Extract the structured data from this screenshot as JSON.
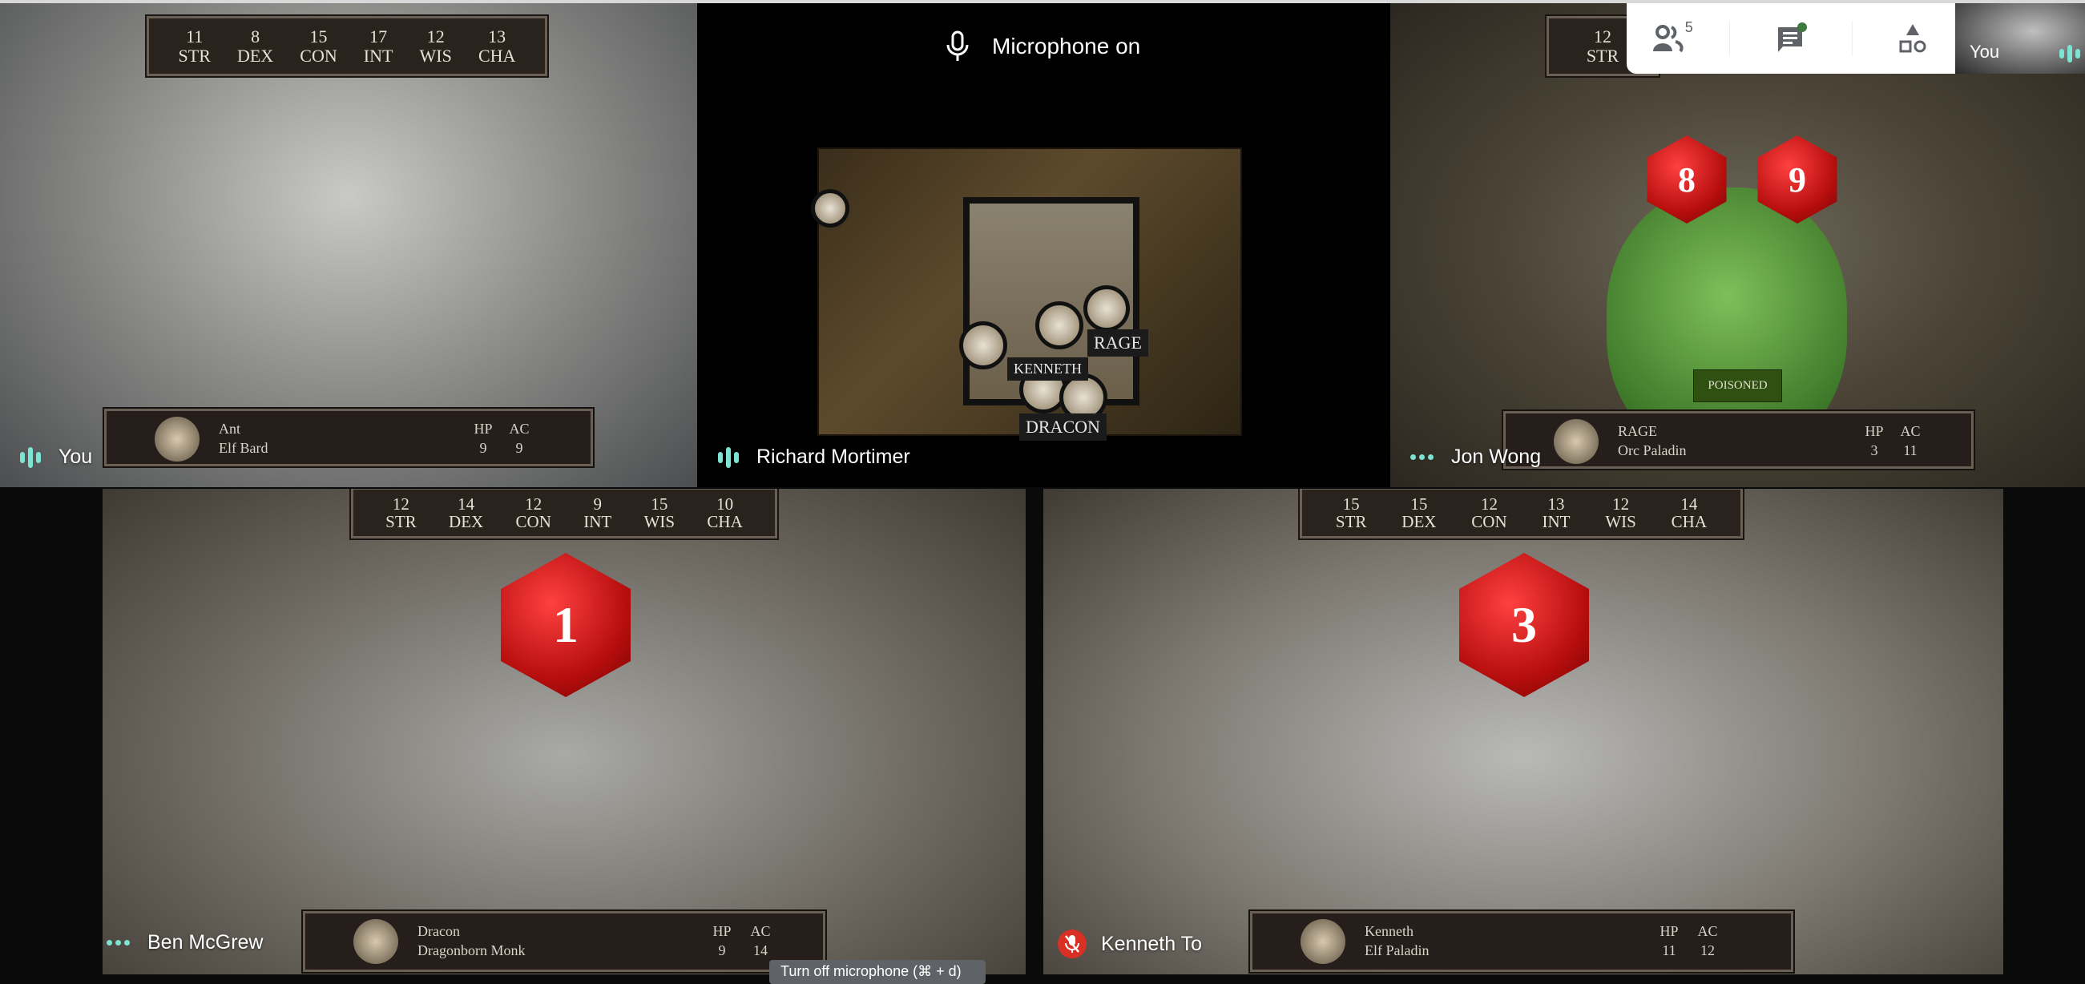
{
  "toast": {
    "text": "Microphone on",
    "icon": "microphone-icon"
  },
  "top_panel": {
    "participants_count": "5",
    "participants_icon": "people-icon",
    "chat_icon": "chat-icon",
    "chat_has_unread": true,
    "activities_icon": "shapes-icon",
    "unread_dot_color": "#3c7a3f"
  },
  "self_view": {
    "label": "You"
  },
  "tooltip": "Turn off microphone (⌘ + d)",
  "colors": {
    "speaking_indicator": "#7de3d3",
    "muted": "#d93025",
    "dice": "#c81414"
  },
  "stat_labels": [
    "STR",
    "DEX",
    "CON",
    "INT",
    "WIS",
    "CHA"
  ],
  "card_headers": {
    "hp": "HP",
    "ac": "AC"
  },
  "participants": [
    {
      "name": "You",
      "status": "speaking",
      "stats": [
        "11",
        "8",
        "15",
        "17",
        "12",
        "13"
      ],
      "character": {
        "name": "Ant",
        "class": "Elf Bard",
        "hp": "9",
        "ac": "9"
      }
    },
    {
      "name": "Richard Mortimer",
      "status": "speaking",
      "map_labels": [
        "RAGE",
        "KENNETH",
        "DRACON"
      ]
    },
    {
      "name": "Jon Wong",
      "status": "idle",
      "stats_partial": {
        "value": "12",
        "label": "STR"
      },
      "dice": [
        "8",
        "9"
      ],
      "condition": "POISONED",
      "character": {
        "name": "RAGE",
        "class": "Orc Paladin",
        "hp": "3",
        "ac": "11"
      }
    },
    {
      "name": "Ben McGrew",
      "status": "idle",
      "stats": [
        "12",
        "14",
        "12",
        "9",
        "15",
        "10"
      ],
      "dice": [
        "1"
      ],
      "character": {
        "name": "Dracon",
        "class": "Dragonborn Monk",
        "hp": "9",
        "ac": "14"
      }
    },
    {
      "name": "Kenneth To",
      "status": "muted",
      "stats": [
        "15",
        "15",
        "12",
        "13",
        "12",
        "14"
      ],
      "dice": [
        "3"
      ],
      "character": {
        "name": "Kenneth",
        "class": "Elf Paladin",
        "hp": "11",
        "ac": "12"
      }
    }
  ]
}
